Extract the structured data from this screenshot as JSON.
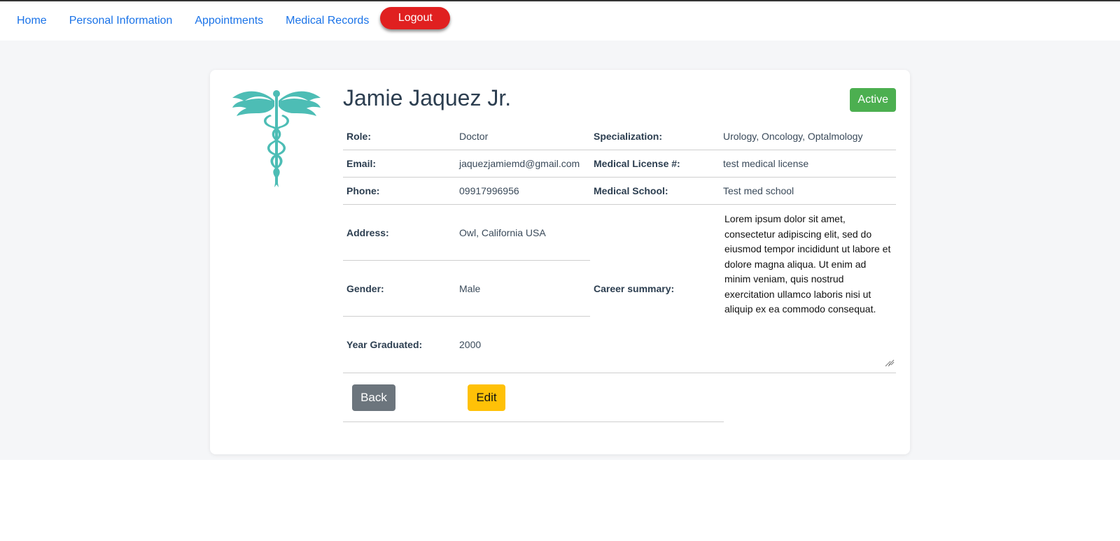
{
  "nav": {
    "links": [
      "Home",
      "Personal Information",
      "Appointments",
      "Medical Records"
    ],
    "logout_label": "Logout"
  },
  "profile": {
    "name": "Jamie Jaquez Jr.",
    "status": "Active",
    "logo_icon": "caduceus-icon",
    "accent_color": "#4dbdb5",
    "fields": {
      "role": {
        "label": "Role:",
        "value": "Doctor"
      },
      "specialization": {
        "label": "Specialization:",
        "value": "Urology, Oncology, Optalmology"
      },
      "email": {
        "label": "Email:",
        "value": "jaquezjamiemd@gmail.com"
      },
      "license": {
        "label": "Medical License #:",
        "value": "test medical license"
      },
      "phone": {
        "label": "Phone:",
        "value": "09917996956"
      },
      "school": {
        "label": "Medical School:",
        "value": "Test med school"
      },
      "address": {
        "label": "Address:",
        "value": "Owl, California USA"
      },
      "gender": {
        "label": "Gender:",
        "value": "Male"
      },
      "year": {
        "label": "Year Graduated:",
        "value": "2000"
      },
      "career": {
        "label": "Career summary:",
        "value": "Lorem ipsum dolor sit amet, consectetur adipiscing elit, sed do eiusmod tempor incididunt ut labore et dolore magna aliqua. Ut enim ad minim veniam, quis nostrud exercitation ullamco laboris nisi ut aliquip ex ea commodo consequat."
      }
    },
    "actions": {
      "back": "Back",
      "edit": "Edit"
    }
  }
}
